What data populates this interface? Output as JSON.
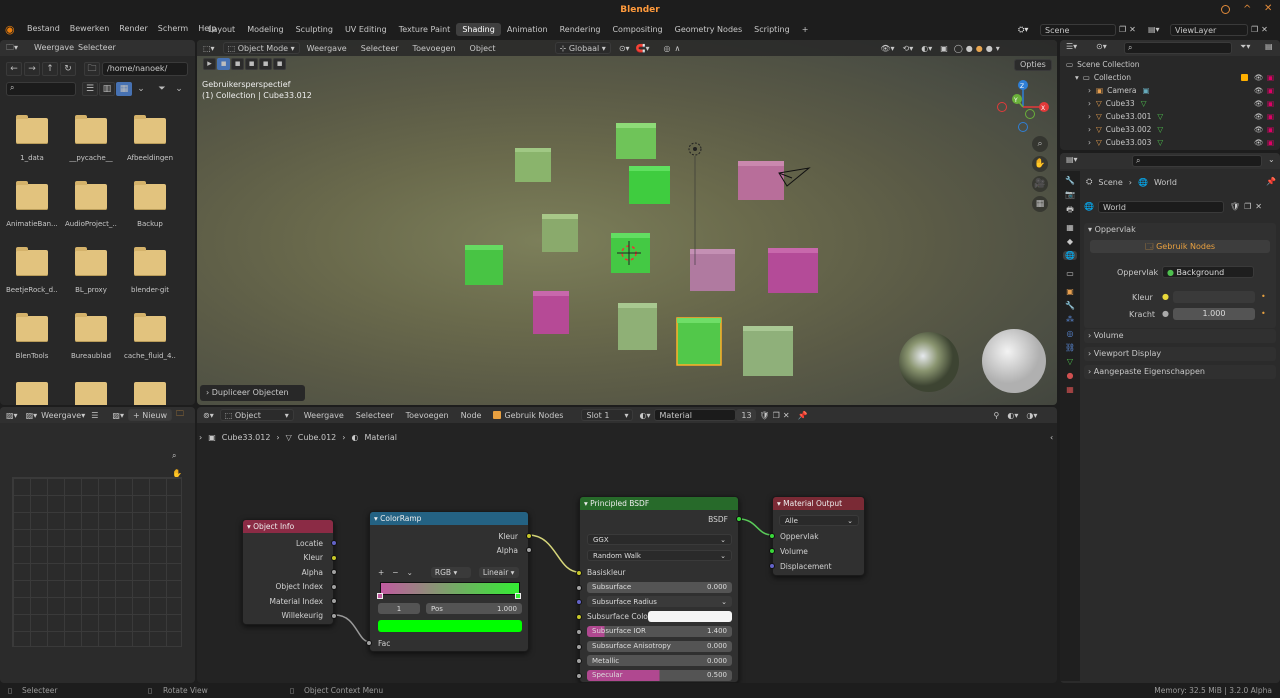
{
  "app": {
    "title": "Blender",
    "memory": "Memory: 32.5 MiB | 3.2.0 Alpha"
  },
  "menu": [
    "Bestand",
    "Bewerken",
    "Render",
    "Scherm",
    "Help"
  ],
  "workspaces": [
    "Layout",
    "Modeling",
    "Sculpting",
    "UV Editing",
    "Texture Paint",
    "Shading",
    "Animation",
    "Rendering",
    "Compositing",
    "Geometry Nodes",
    "Scripting"
  ],
  "active_workspace": "Shading",
  "scene_name": "Scene",
  "view_layer": "ViewLayer",
  "filebrowser": {
    "menu": [
      "Weergave",
      "Selecteer"
    ],
    "path": "/home/nanoek/",
    "folders": [
      "1_data",
      "__pycache__",
      "Afbeeldingen",
      "AnimatieBan...",
      "AudioProject_...",
      "Backup",
      "BeetjeRock_d...",
      "BL_proxy",
      "blender-git",
      "BlenTools",
      "Bureaublad",
      "cache_fluid_4..."
    ]
  },
  "viewport": {
    "mode": "Object Mode",
    "menu": [
      "Weergave",
      "Selecteer",
      "Toevoegen",
      "Object"
    ],
    "transform": "Globaal",
    "options": "Opties",
    "info1": "Gebruikersperspectief",
    "info2": "(1) Collection | Cube33.012",
    "last_op": "Dupliceer Objecten"
  },
  "image_editor": {
    "menu": "Weergave",
    "new_label": "+ Nieuw"
  },
  "node_editor": {
    "type": "Object",
    "menu": [
      "Weergave",
      "Selecteer",
      "Toevoegen",
      "Node"
    ],
    "use_nodes": "Gebruik Nodes",
    "slot": "Slot 1",
    "material": "Material",
    "users": "13",
    "breadcrumb": [
      "Cube33.012",
      "Cube.012",
      "Material"
    ],
    "nodes": {
      "object_info": {
        "title": "Object Info",
        "outputs": [
          "Locatie",
          "Kleur",
          "Alpha",
          "Object Index",
          "Material Index",
          "Willekeurig"
        ]
      },
      "colorramp": {
        "title": "ColorRamp",
        "outputs": [
          "Kleur",
          "Alpha"
        ],
        "mode": "RGB",
        "interp": "Lineair",
        "index": "1",
        "pos_label": "Pos",
        "pos_value": "1.000",
        "input": "Fac"
      },
      "bsdf": {
        "title": "Principled BSDF",
        "output": "BSDF",
        "distribution": "GGX",
        "sss_method": "Random Walk",
        "fields": [
          {
            "label": "Basiskleur",
            "value": "",
            "kind": "socket"
          },
          {
            "label": "Subsurface",
            "value": "0.000",
            "kind": "num"
          },
          {
            "label": "Subsurface Radius",
            "value": "",
            "kind": "drop"
          },
          {
            "label": "Subsurface Color",
            "value": "",
            "kind": "color"
          },
          {
            "label": "Subsurface IOR",
            "value": "1.400",
            "kind": "num"
          },
          {
            "label": "Subsurface Anisotropy",
            "value": "0.000",
            "kind": "num"
          },
          {
            "label": "Metallic",
            "value": "0.000",
            "kind": "num"
          },
          {
            "label": "Specular",
            "value": "0.500",
            "kind": "num"
          }
        ]
      },
      "output": {
        "title": "Material Output",
        "target": "Alle",
        "inputs": [
          "Oppervlak",
          "Volume",
          "Displacement"
        ]
      }
    }
  },
  "outliner": {
    "root": "Scene Collection",
    "collection": "Collection",
    "items": [
      "Camera",
      "Cube33",
      "Cube33.001",
      "Cube33.002",
      "Cube33.003"
    ]
  },
  "properties": {
    "breadcrumb": [
      "Scene",
      "World"
    ],
    "world_name": "World",
    "panel": "Oppervlak",
    "use_nodes": "Gebruik Nodes",
    "surface_label": "Oppervlak",
    "surface_value": "Background",
    "color_label": "Kleur",
    "strength_label": "Kracht",
    "strength_value": "1.000",
    "collapsed": [
      "Volume",
      "Viewport Display",
      "Aangepaste Eigenschappen"
    ]
  },
  "status": {
    "left": "Selecteer",
    "mid": "Rotate View",
    "right": "Object Context Menu"
  },
  "colors": {
    "accent": "#4772b3",
    "green_cube": "#36c236",
    "pink_cube": "#b54d93",
    "active": "#ffaf29"
  }
}
